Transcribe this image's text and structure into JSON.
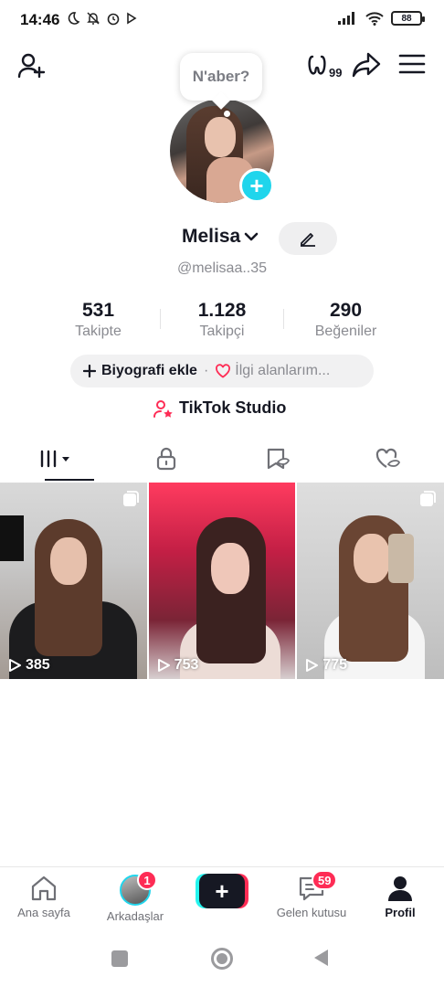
{
  "status_bar": {
    "time": "14:46",
    "battery": "88"
  },
  "bubble": {
    "text": "N'aber?"
  },
  "profile": {
    "display_name": "Melisa",
    "username": "@melisaa..35"
  },
  "stats": [
    {
      "value": "531",
      "label": "Takipte"
    },
    {
      "value": "1.128",
      "label": "Takipçi"
    },
    {
      "value": "290",
      "label": "Beğeniler"
    }
  ],
  "bio": {
    "add_label": "Biyografi ekle",
    "separator": "·",
    "interests_label": "İlgi alanlarım..."
  },
  "studio": {
    "label": "TikTok Studio"
  },
  "videos": [
    {
      "views": "385"
    },
    {
      "views": "753"
    },
    {
      "views": "775"
    }
  ],
  "bottom_nav": {
    "home": "Ana sayfa",
    "friends": "Arkadaşlar",
    "friends_badge": "1",
    "inbox": "Gelen kutusu",
    "inbox_badge": "59",
    "profile": "Profil"
  },
  "colors": {
    "accent_cyan": "#20d5ec",
    "accent_red": "#fe2c55",
    "text_primary": "#161823",
    "text_secondary": "#8a8b91"
  },
  "icons": {
    "top_left": "add-friend-icon",
    "top_right": [
      "glasses-icon",
      "share-icon",
      "menu-icon"
    ],
    "tabs": [
      "grid-icon",
      "lock-icon",
      "bookmark-icon",
      "liked-icon"
    ]
  }
}
